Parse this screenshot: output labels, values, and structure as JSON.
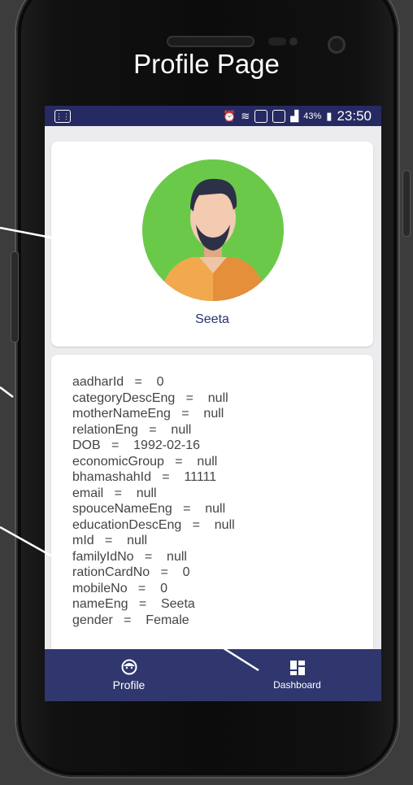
{
  "page": {
    "title": "Profile Page"
  },
  "status_bar": {
    "battery": "43%",
    "time": "23:50"
  },
  "profile": {
    "name": "Seeta"
  },
  "details": [
    {
      "key": "aadharId",
      "value": "0"
    },
    {
      "key": "categoryDescEng",
      "value": "null"
    },
    {
      "key": "motherNameEng",
      "value": "null"
    },
    {
      "key": "relationEng",
      "value": "null"
    },
    {
      "key": "DOB",
      "value": "1992-02-16"
    },
    {
      "key": "economicGroup",
      "value": "null"
    },
    {
      "key": "bhamashahId",
      "value": "11111"
    },
    {
      "key": "email",
      "value": "null"
    },
    {
      "key": "spouceNameEng",
      "value": "null"
    },
    {
      "key": "educationDescEng",
      "value": "null"
    },
    {
      "key": "mId",
      "value": "null"
    },
    {
      "key": "familyIdNo",
      "value": "null"
    },
    {
      "key": "rationCardNo",
      "value": "0"
    },
    {
      "key": "mobileNo",
      "value": "0"
    },
    {
      "key": "nameEng",
      "value": "Seeta"
    },
    {
      "key": "gender",
      "value": "Female"
    }
  ],
  "bottom_nav": {
    "profile_label": "Profile",
    "dashboard_label": "Dashboard"
  },
  "colors": {
    "primary": "#30376e",
    "avatar_bg": "#6bc94a",
    "name_text": "#273170"
  }
}
